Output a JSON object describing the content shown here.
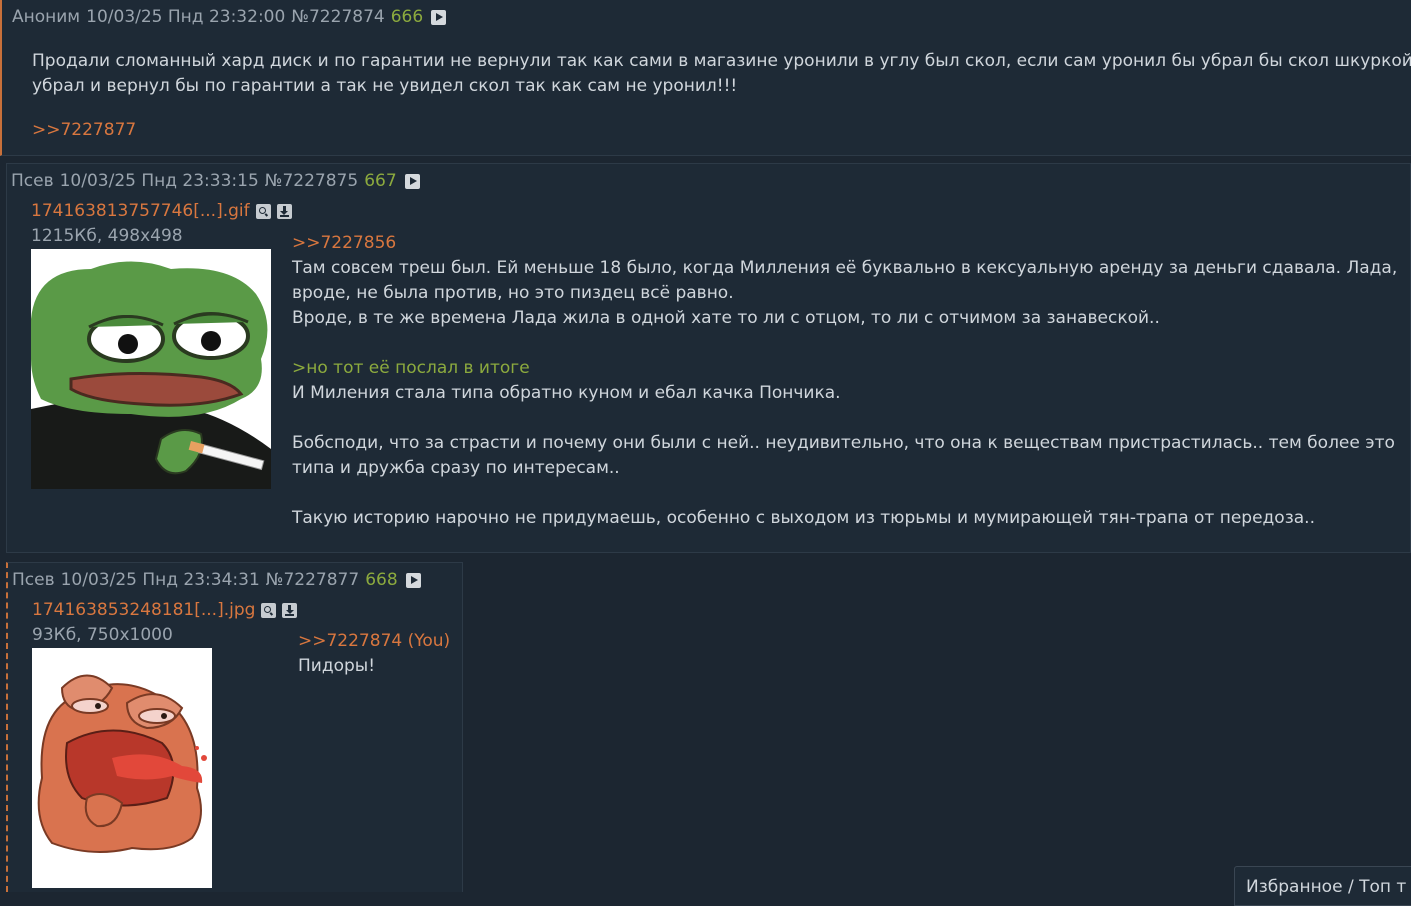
{
  "posts": [
    {
      "author": "Аноним",
      "date": "10/03/25 Пнд 23:32:00",
      "post_id": "№7227874",
      "ordinal": "666",
      "body_lines": [
        "Продали сломанный хард диск и по гарантии не вернули так как сами в магазине уронили в углу был скол, если сам уронил бы убрал бы скол шкуркой",
        "убрал и вернул бы по гарантии а так не увидел скол так как сам не уронил!!!"
      ],
      "reply_link": ">>7227877"
    },
    {
      "author": "Псев",
      "date": "10/03/25 Пнд 23:33:15",
      "post_id": "№7227875",
      "ordinal": "667",
      "file": {
        "name": "174163813757746[...].gif",
        "info": "1215Кб, 498x498",
        "thumb_icon": "smoking-frog-image"
      },
      "quote_link": ">>7227856",
      "body_lines": [
        "Там совсем треш был. Ей меньше 18 было, когда Милления её буквально в кексуальную аренду за деньги сдавала. Лада,",
        "вроде, не была против, но это пиздец всё равно.",
        "Вроде, в те же времена Лада жила в одной хате то ли с отцом, то ли с отчимом за занавеской..",
        "",
        ">но тот её послал в итоге",
        "И Миления стала типа обратно куном и ебал качка Пончика.",
        "",
        "Бобсподи, что за страсти и почему они были с ней.. неудивительно, что она к веществам пристрастилась.. тем более это",
        "типа и дружба сразу по интересам..",
        "",
        "Такую историю нарочно не придумаешь, особенно с выходом из тюрьмы и мумирающей тян-трапа от передоза.."
      ]
    },
    {
      "author": "Псев",
      "date": "10/03/25 Пнд 23:34:31",
      "post_id": "№7227877",
      "ordinal": "668",
      "file": {
        "name": "174163853248181[...].jpg",
        "info": "93Кб, 750x1000",
        "thumb_icon": "screaming-frog-image"
      },
      "quote_link": ">>7227874 (You)",
      "body_lines": [
        "Пидоры!"
      ]
    }
  ],
  "bottom_widget": {
    "label": "Избранное / Топ т"
  },
  "colors": {
    "background": "#1c2631",
    "post": "#1e2a36",
    "link": "#d9773f",
    "green": "#8caa3e",
    "text": "#d0d6dc",
    "meta": "#9aa4ae"
  }
}
